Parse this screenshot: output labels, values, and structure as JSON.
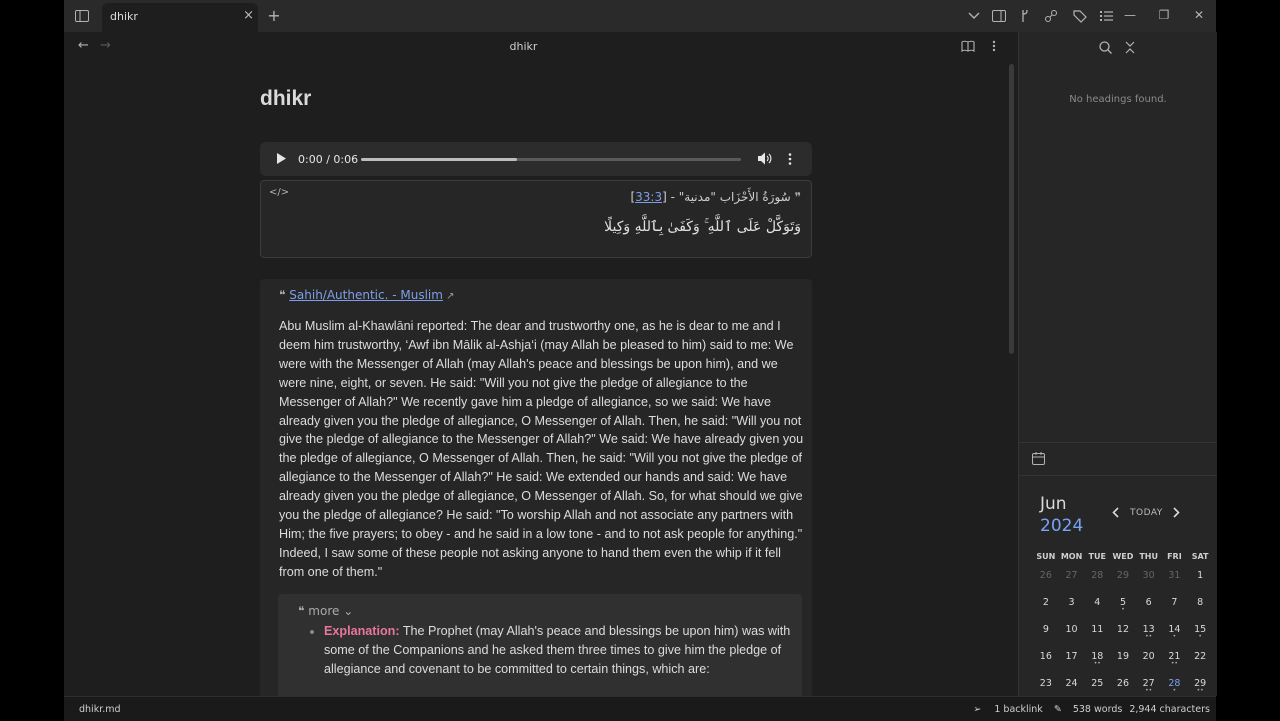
{
  "tab": {
    "title": "dhikr",
    "close_glyph": "×",
    "new_glyph": "+"
  },
  "window": {
    "minimize": "—",
    "maximize": "❐",
    "close": "✕"
  },
  "nav": {
    "back": "←",
    "forward": "→"
  },
  "view": {
    "title": "dhikr"
  },
  "note": {
    "heading": "dhikr"
  },
  "audio": {
    "time": "0:00 / 0:06",
    "progress_fraction": 0.41
  },
  "quran": {
    "code_icon": "</>",
    "source_prefix": "سُورَةُ الأَحْزَاب \"مدنية\" - [",
    "source_ref": "33:3",
    "source_suffix": "]",
    "ayah": "وَتَوَكَّلْ عَلَى ٱللَّهِ ۚ وَكَفَىٰ بِٱللَّهِ وَكِيلًا"
  },
  "hadith": {
    "grade_link": "Sahih/Authentic. - Muslim",
    "text": "Abu Muslim al-Khawlāni reported: The dear and trustworthy one, as he is dear to me and I deem him trustworthy, ‘Awf ibn Mālik al-Ashja‘i (may Allah be pleased to him) said to me: We were with the Messenger of Allah (may Allah's peace and blessings be upon him), and we were nine, eight, or seven. He said: \"Will you not give the pledge of allegiance to the Messenger of Allah?\" We recently gave him a pledge of allegiance, so we said: We have already given you the pledge of allegiance, O Messenger of Allah. Then, he said: \"Will you not give the pledge of allegiance to the Messenger of Allah?\" We said: We have already given you the pledge of allegiance, O Messenger of Allah. Then, he said: \"Will you not give the pledge of allegiance to the Messenger of Allah?\" He said: We extended our hands and said: We have already given you the pledge of allegiance, O Messenger of Allah. So, for what should we give you the pledge of allegiance? He said: \"To worship Allah and not associate any partners with Him; the five prayers; to obey - and he said in a low tone - and to not ask people for anything.\" Indeed, I saw some of these people not asking anyone to hand them even the whip if it fell from one of them.\"",
    "more_label": "more",
    "explanation_label": "Explanation:",
    "explanation_text": " The Prophet (may Allah's peace and blessings be upon him) was with some of the Companions and he asked them three times to give him the pledge of allegiance and covenant to be committed to certain things, which are:"
  },
  "outline": {
    "empty_text": "No headings found."
  },
  "calendar": {
    "month": "Jun",
    "year": "2024",
    "today_label": "TODAY",
    "weekdays": [
      "SUN",
      "MON",
      "TUE",
      "WED",
      "THU",
      "FRI",
      "SAT"
    ],
    "weeks": [
      [
        {
          "d": "26",
          "adj": true
        },
        {
          "d": "27",
          "adj": true
        },
        {
          "d": "28",
          "adj": true
        },
        {
          "d": "29",
          "adj": true
        },
        {
          "d": "30",
          "adj": true
        },
        {
          "d": "31",
          "adj": true
        },
        {
          "d": "1"
        }
      ],
      [
        {
          "d": "2"
        },
        {
          "d": "3"
        },
        {
          "d": "4"
        },
        {
          "d": "5",
          "dots": "•"
        },
        {
          "d": "6"
        },
        {
          "d": "7"
        },
        {
          "d": "8"
        }
      ],
      [
        {
          "d": "9"
        },
        {
          "d": "10"
        },
        {
          "d": "11"
        },
        {
          "d": "12"
        },
        {
          "d": "13",
          "dots": "••"
        },
        {
          "d": "14",
          "dots": "•"
        },
        {
          "d": "15",
          "dots": "•"
        }
      ],
      [
        {
          "d": "16"
        },
        {
          "d": "17"
        },
        {
          "d": "18",
          "dots": "••"
        },
        {
          "d": "19"
        },
        {
          "d": "20"
        },
        {
          "d": "21",
          "dots": "••"
        },
        {
          "d": "22"
        }
      ],
      [
        {
          "d": "23"
        },
        {
          "d": "24"
        },
        {
          "d": "25"
        },
        {
          "d": "26"
        },
        {
          "d": "27",
          "dots": "••"
        },
        {
          "d": "28",
          "cur": true,
          "dots": "•"
        },
        {
          "d": "29",
          "dots": "••"
        }
      ]
    ]
  },
  "status": {
    "file": "dhikr.md",
    "backlinks": "1 backlink",
    "words": "538 words",
    "chars": "2,944 characters"
  },
  "colors": {
    "accent": "#7aa2f7",
    "link": "#7f9ee8",
    "label_pink": "#e8769f"
  },
  "icons": [
    "sidebar-toggle-icon",
    "chevron-down-icon",
    "layout-icon",
    "branch-icon",
    "graph-icon",
    "tags-icon",
    "list-icon",
    "book-icon",
    "more-vertical-icon",
    "search-icon",
    "collapse-icon",
    "calendar-icon",
    "play-icon",
    "volume-icon",
    "quote-icon",
    "external-link-icon",
    "send-icon",
    "edit-icon",
    "chevron-left-icon",
    "chevron-right-icon"
  ]
}
